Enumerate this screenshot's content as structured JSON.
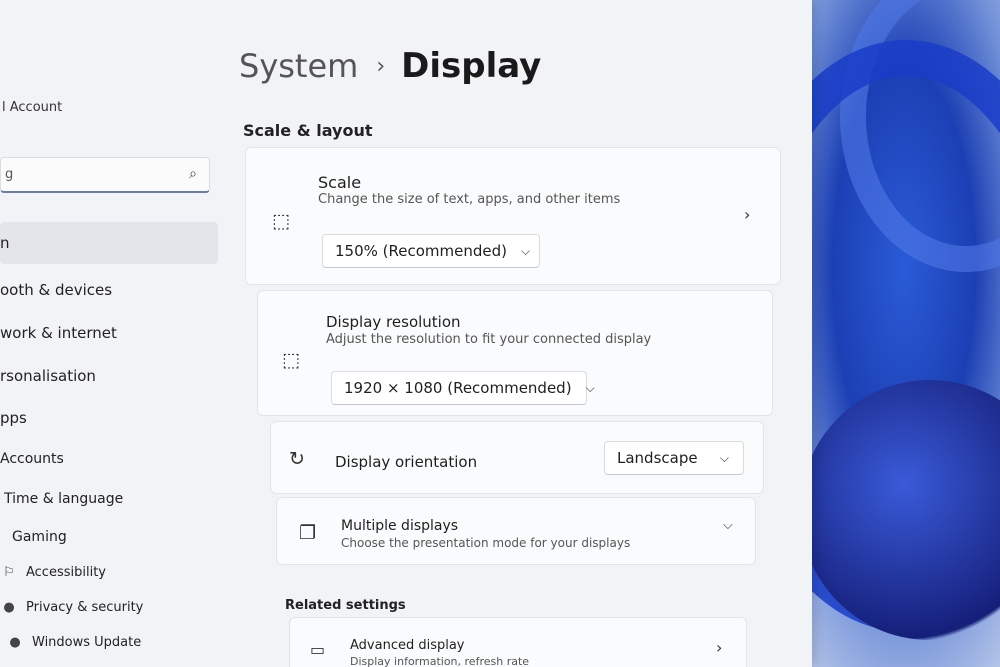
{
  "sidebar": {
    "account_name": "l Account",
    "search": {
      "value": "g",
      "placeholder": ""
    },
    "items": [
      {
        "label": "n",
        "icon": ""
      },
      {
        "label": "ooth & devices",
        "icon": ""
      },
      {
        "label": "work & internet",
        "icon": ""
      },
      {
        "label": "rsonalisation",
        "icon": ""
      },
      {
        "label": "pps",
        "icon": ""
      },
      {
        "label": "Accounts",
        "icon": ""
      },
      {
        "label": "Time & language",
        "icon": ""
      },
      {
        "label": "Gaming",
        "icon": ""
      },
      {
        "label": "Accessibility",
        "icon": "accessibility-icon"
      },
      {
        "label": "Privacy & security",
        "icon": "shield-icon"
      },
      {
        "label": "Windows Update",
        "icon": "update-icon"
      }
    ]
  },
  "header": {
    "parent": "System",
    "current": "Display"
  },
  "section": {
    "title": "Scale & layout"
  },
  "scale": {
    "title": "Scale",
    "desc": "Change the size of text, apps, and other items",
    "value": "150% (Recommended)"
  },
  "resolution": {
    "title": "Display resolution",
    "desc": "Adjust the resolution to fit your connected display",
    "value": "1920 × 1080 (Recommended)"
  },
  "orientation": {
    "title": "Display orientation",
    "value": "Landscape"
  },
  "multiple": {
    "title": "Multiple displays",
    "desc": "Choose the presentation mode for your displays"
  },
  "related": {
    "title": "Related settings",
    "advanced": {
      "title": "Advanced display",
      "desc": "Display information, refresh rate"
    }
  },
  "colors": {
    "accent": "#6b7bb0",
    "background": "#f2f3f6",
    "card": "#fafbfc"
  }
}
